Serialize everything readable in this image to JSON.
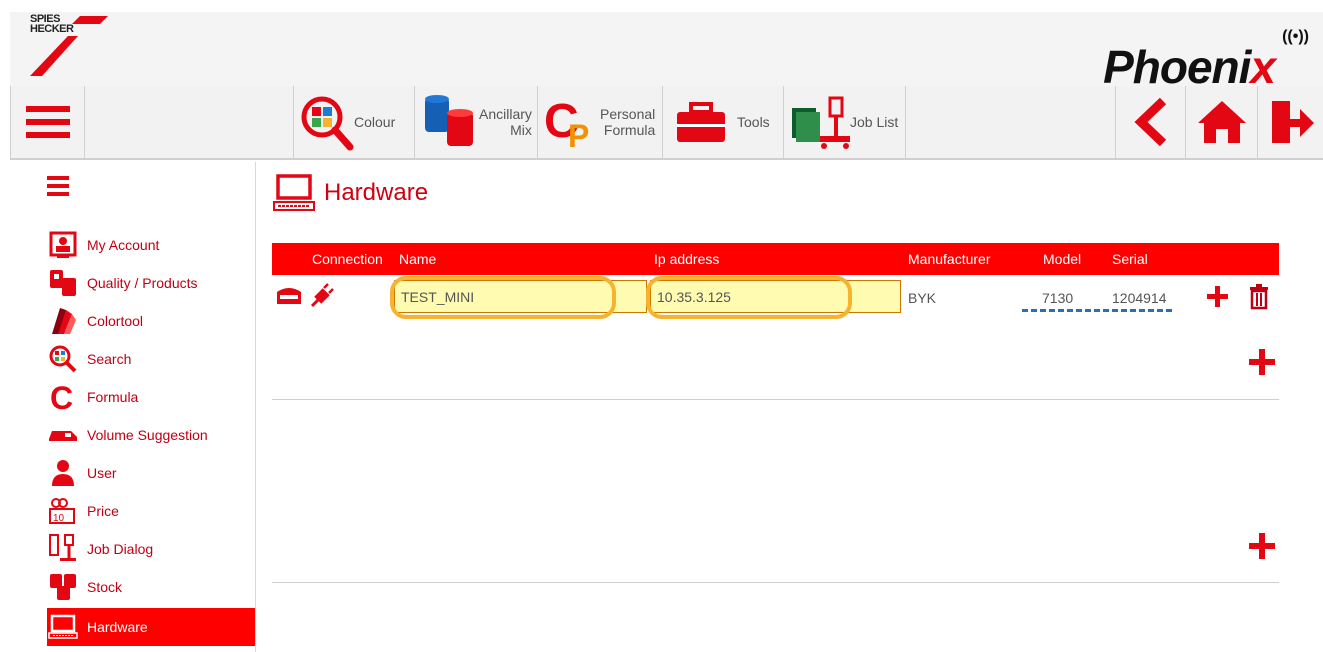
{
  "brand": {
    "logo_line1": "SPIES",
    "logo_line2": "HECKER",
    "app_name_main": "Phoeni",
    "app_name_accent": "x",
    "accent_color": "#e30613"
  },
  "toolbar": {
    "colour_label": "Colour",
    "ancillary_label_1": "Ancillary",
    "ancillary_label_2": "Mix",
    "personal_label_1": "Personal",
    "personal_label_2": "Formula",
    "tools_label": "Tools",
    "joblist_label": "Job List"
  },
  "sidebar": {
    "items": [
      {
        "label": "My Account"
      },
      {
        "label": "Quality / Products"
      },
      {
        "label": "Colortool"
      },
      {
        "label": "Search"
      },
      {
        "label": "Formula"
      },
      {
        "label": "Volume Suggestion"
      },
      {
        "label": "User"
      },
      {
        "label": "Price"
      },
      {
        "label": "Job Dialog"
      },
      {
        "label": "Stock"
      },
      {
        "label": "Hardware"
      }
    ],
    "active_index": 10
  },
  "page": {
    "title": "Hardware"
  },
  "table": {
    "headers": {
      "connection": "Connection",
      "name": "Name",
      "ip": "Ip address",
      "manufacturer": "Manufacturer",
      "model": "Model",
      "serial": "Serial"
    },
    "row": {
      "name": "TEST_MINI",
      "ip": "10.35.3.125",
      "manufacturer": "BYK",
      "model": "7130",
      "serial": "1204914"
    }
  }
}
